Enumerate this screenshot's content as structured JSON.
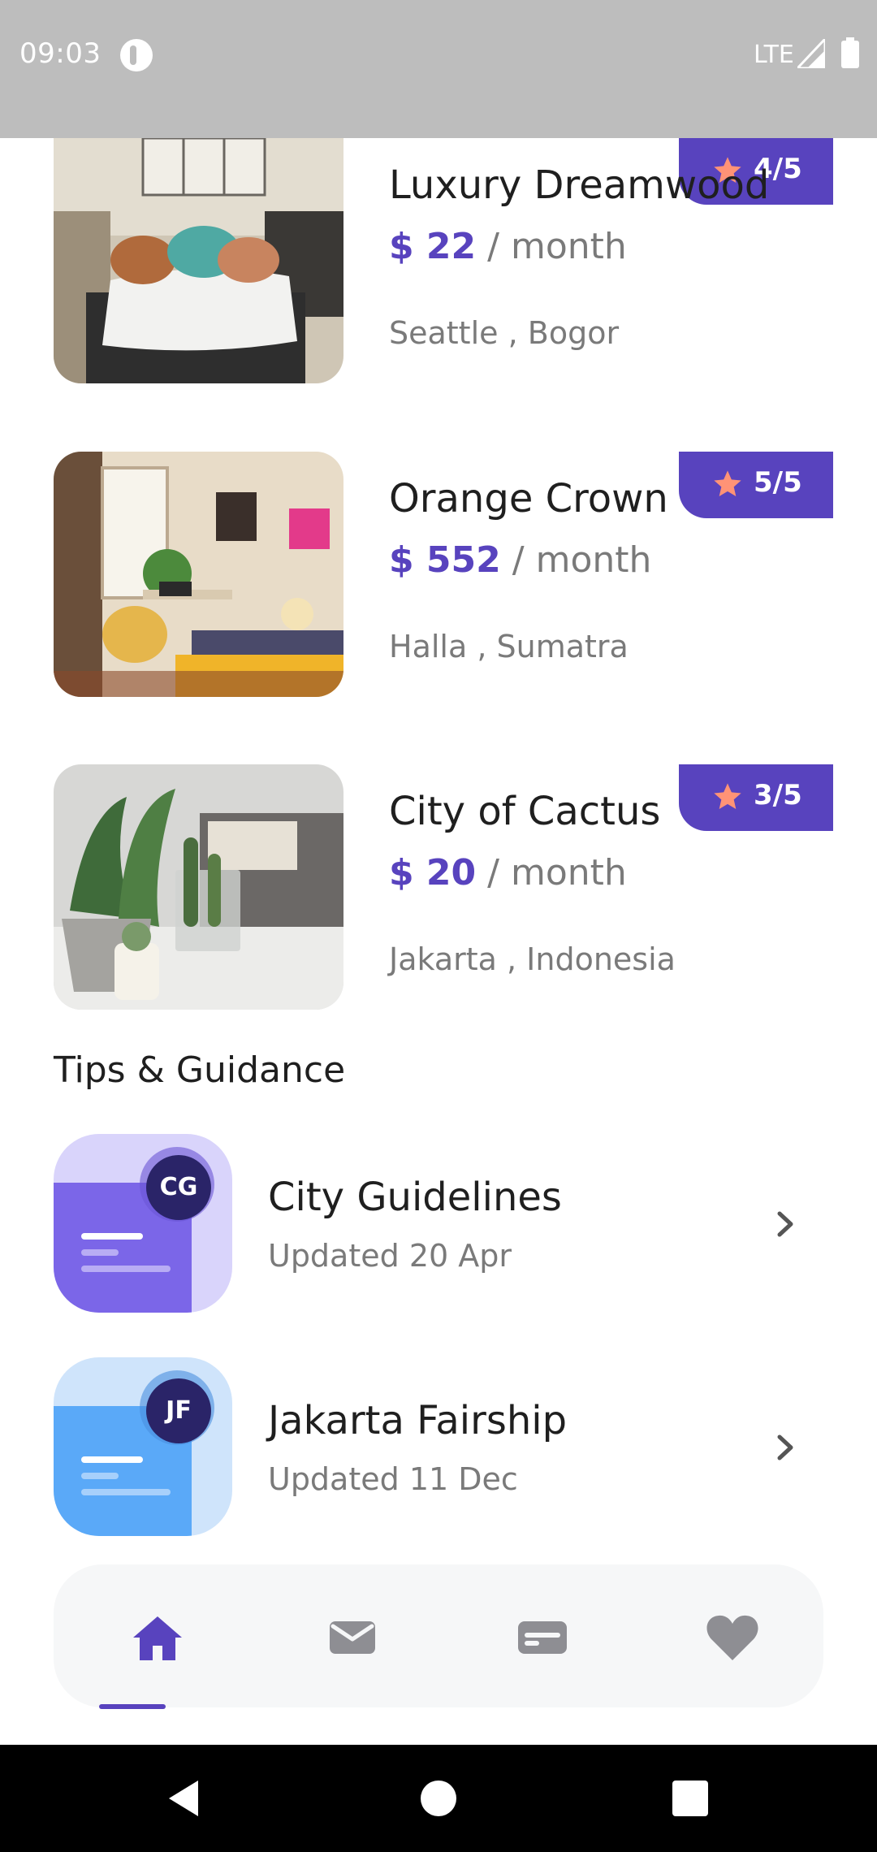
{
  "status_bar": {
    "time": "09:03",
    "network": "LTE"
  },
  "listings": [
    {
      "name": "Luxury Dreamwood",
      "price": "$ 22",
      "period": " / month",
      "location": "Seattle , Bogor",
      "rating": "4/5",
      "rating_value": 4,
      "rating_max": 5
    },
    {
      "name": "Orange Crown",
      "price": "$ 552",
      "period": " / month",
      "location": "Halla , Sumatra",
      "rating": "5/5",
      "rating_value": 5,
      "rating_max": 5
    },
    {
      "name": "City of Cactus",
      "price": "$ 20",
      "period": " / month",
      "location": "Jakarta , Indonesia",
      "rating": "3/5",
      "rating_value": 3,
      "rating_max": 5
    }
  ],
  "tips_section": {
    "title": "Tips & Guidance",
    "items": [
      {
        "initials": "CG",
        "title": "City Guidelines",
        "subtitle": "Updated 20 Apr",
        "icon_color": "#7b66e8",
        "icon_bg": "#d9d4fb"
      },
      {
        "initials": "JF",
        "title": "Jakarta Fairship",
        "subtitle": "Updated 11 Dec",
        "icon_color": "#5aa9f8",
        "icon_bg": "#cfe4fb"
      }
    ]
  },
  "bottom_nav": {
    "items": [
      {
        "icon": "home-icon",
        "active": true
      },
      {
        "icon": "mail-icon",
        "active": false
      },
      {
        "icon": "card-icon",
        "active": false
      },
      {
        "icon": "heart-icon",
        "active": false
      }
    ]
  },
  "colors": {
    "accent": "#5843be",
    "rating_star": "#ff9376",
    "text_primary": "#1f1f1f",
    "text_secondary": "#7a7a7a",
    "nav_inactive": "#8e8e93"
  }
}
